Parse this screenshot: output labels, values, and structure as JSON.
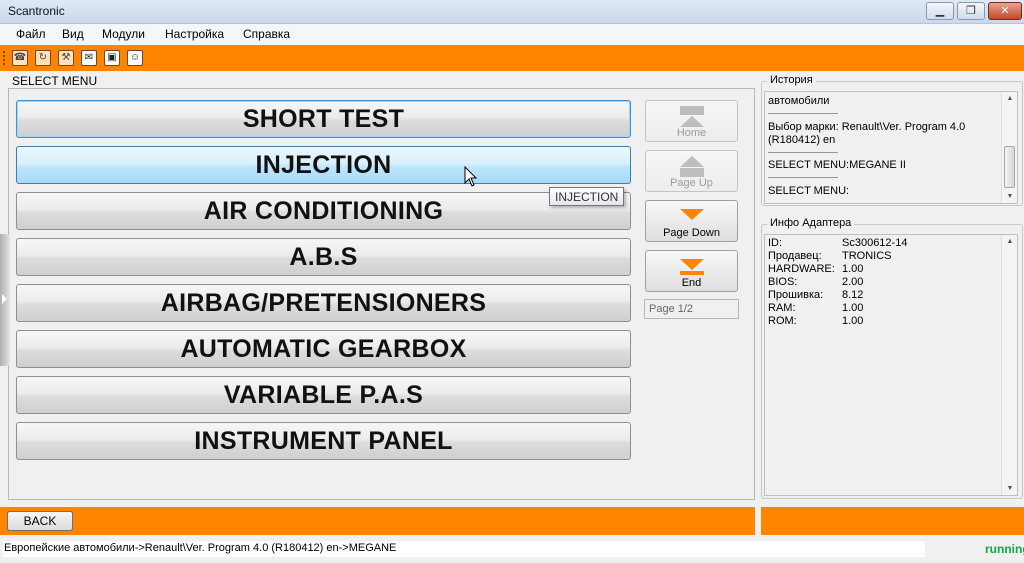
{
  "window": {
    "title": "Scantronic",
    "min_glyph": "▁",
    "max_glyph": "❐",
    "close_glyph": "✕"
  },
  "menubar": {
    "items": [
      "Файл",
      "Вид",
      "Модули",
      "Настройка",
      "Справка"
    ]
  },
  "toolbar": {
    "icons": [
      "phone-icon",
      "refresh-icon",
      "tools-icon",
      "mail-icon",
      "camera-icon",
      "face-icon"
    ],
    "glyphs": [
      "☎",
      "↻",
      "⚒",
      "✉",
      "▣",
      "☺"
    ]
  },
  "select_menu": {
    "label": "SELECT MENU",
    "items": [
      "SHORT TEST",
      "INJECTION",
      "AIR CONDITIONING",
      "A.B.S",
      "AIRBAG/PRETENSIONERS",
      "AUTOMATIC GEARBOX",
      "VARIABLE P.A.S",
      "INSTRUMENT PANEL"
    ],
    "focused_index": 0,
    "hovered_index": 1,
    "tooltip": "INJECTION"
  },
  "navigation": {
    "home": "Home",
    "page_up": "Page Up",
    "page_down": "Page Down",
    "end": "End",
    "page_indicator": "Page 1/2"
  },
  "history": {
    "title": "История",
    "lines": [
      "автомобили",
      "-----------------------------------",
      "Выбор марки: Renault\\Ver. Program 4.0",
      "(R180412) en",
      "-----------------------------------",
      "SELECT MENU:MEGANE II",
      "-----------------------------------",
      "SELECT MENU:"
    ]
  },
  "adapter_info": {
    "title": "Инфо Адаптера",
    "rows": [
      {
        "key": "ID:",
        "value": "Sc300612-14"
      },
      {
        "key": "Продавец:",
        "value": "TRONICS"
      },
      {
        "key": "HARDWARE:",
        "value": "1.00"
      },
      {
        "key": "BIOS:",
        "value": "2.00"
      },
      {
        "key": "Прошивка:",
        "value": "8.12"
      },
      {
        "key": "RAM:",
        "value": "1.00"
      },
      {
        "key": "ROM:",
        "value": "1.00"
      }
    ]
  },
  "bottom": {
    "back_label": "BACK"
  },
  "status": {
    "path": "Европейские автомобили->Renault\\Ver. Program 4.0 (R180412) en->MEGANE",
    "state": "running"
  },
  "colors": {
    "accent": "#ff8500",
    "hover": "#bee6fd",
    "running": "#1aa34a"
  }
}
